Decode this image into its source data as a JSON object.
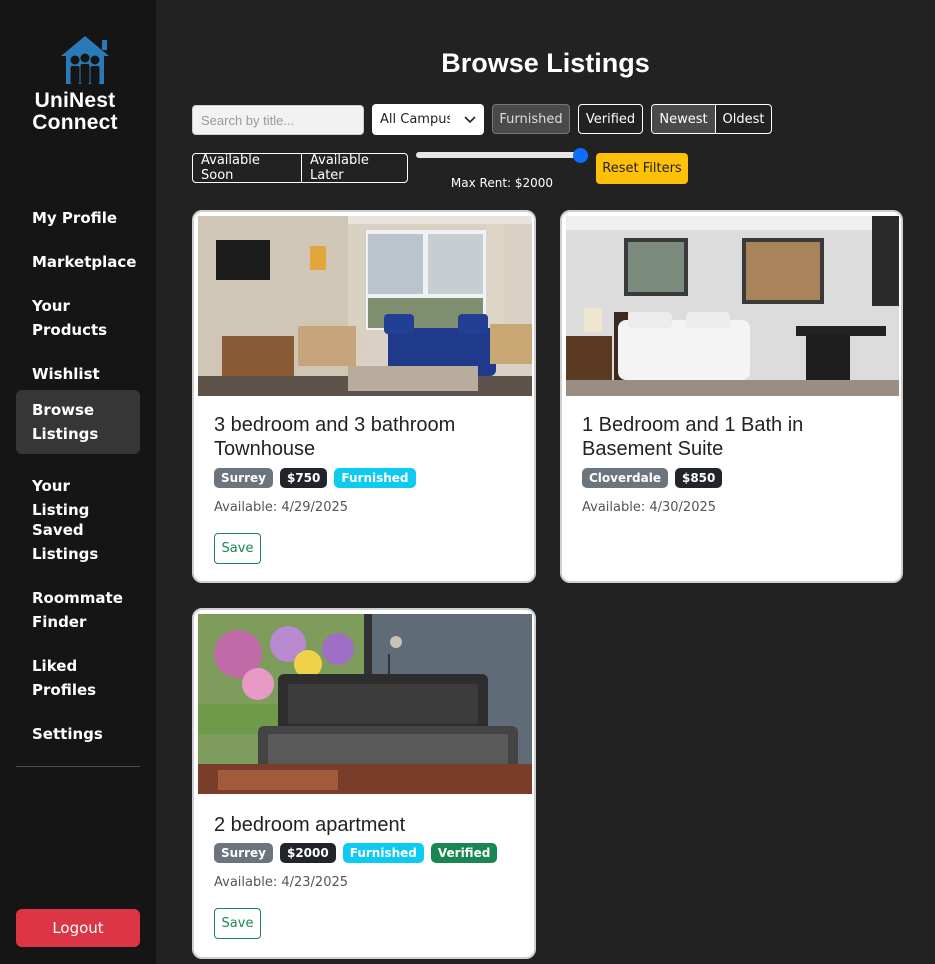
{
  "app": {
    "logo_line1": "UniNest",
    "logo_line2": "Connect"
  },
  "sidebar": {
    "items": [
      {
        "label": "My Profile"
      },
      {
        "label": "Marketplace"
      },
      {
        "label": "Your\nProducts"
      },
      {
        "label": "Wishlist"
      },
      {
        "label": "Browse\nListings",
        "active": true
      },
      {
        "label": "Your Listing"
      },
      {
        "label": "Saved\nListings"
      },
      {
        "label": "Roommate\nFinder"
      },
      {
        "label": "Liked\nProfiles"
      },
      {
        "label": "Settings"
      }
    ],
    "logout_label": "Logout"
  },
  "main": {
    "title": "Browse Listings",
    "filters": {
      "search_placeholder": "Search by title...",
      "campus_selected": "All Campuses",
      "furnished_label": "Furnished",
      "verified_label": "Verified",
      "sort": {
        "newest": "Newest",
        "oldest": "Oldest",
        "selected": "Newest"
      },
      "availability": {
        "soon": "Available Soon",
        "later": "Available Later"
      },
      "max_rent_label": "Max Rent: $2000",
      "max_rent_value": 2000,
      "reset_label": "Reset Filters"
    },
    "listings": [
      {
        "title": "3 bedroom and 3 bathroom Townhouse",
        "location": "Surrey",
        "price": "$750",
        "furnished": "Furnished",
        "available": "Available: 4/29/2025",
        "save_label": "Save"
      },
      {
        "title": "1 Bedroom and 1 Bath in Basement Suite",
        "location": "Cloverdale",
        "price": "$850",
        "available": "Available: 4/30/2025"
      },
      {
        "title": "2 bedroom apartment",
        "location": "Surrey",
        "price": "$2000",
        "furnished": "Furnished",
        "verified": "Verified",
        "available": "Available: 4/23/2025",
        "save_label": "Save"
      }
    ]
  },
  "colors": {
    "accent_blue": "#0d6efd",
    "danger": "#dc3545",
    "warning": "#ffc107",
    "badge_cyan": "#0dcaf0",
    "badge_green": "#198754",
    "logo_blue": "#2a7ab8"
  }
}
